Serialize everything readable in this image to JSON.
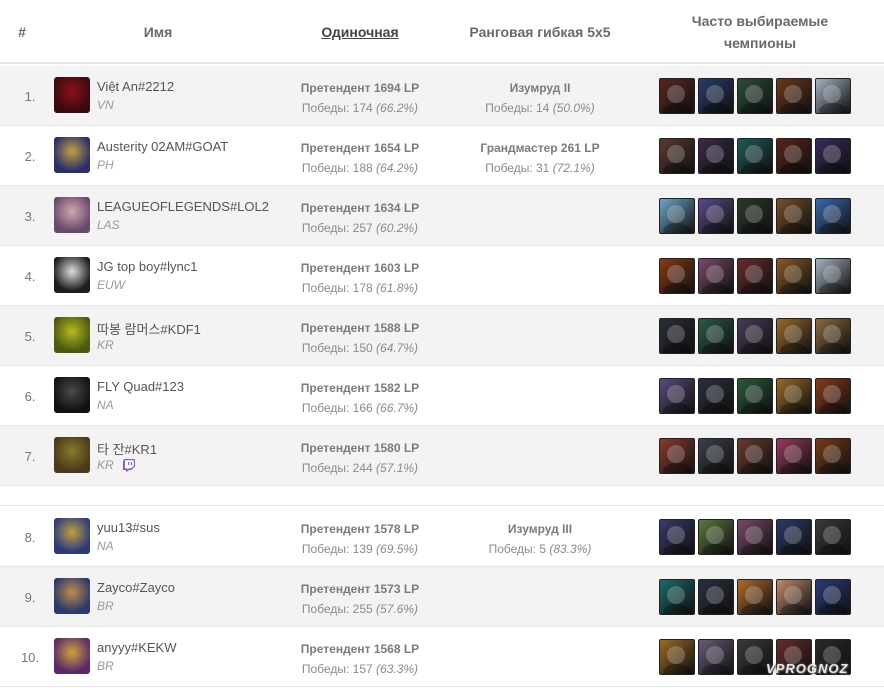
{
  "header": {
    "rank": "#",
    "name": "Имя",
    "solo": "Одиночная",
    "flex": "Ранговая гибкая 5х5",
    "champs_line1": "Часто выбираемые",
    "champs_line2": "чемпионы"
  },
  "rows": [
    {
      "rank": "1.",
      "name": "Việt An#2212",
      "region": "VN",
      "solo_tier": "Претендент 1694 LP",
      "solo_wins": "Победы: 174",
      "solo_wr": "(66.2%)",
      "flex_tier": "Изумруд II",
      "flex_wins": "Победы: 14",
      "flex_wr": "(50.0%)",
      "avatar_colors": [
        "#3a0a0e",
        "#8e1020"
      ],
      "champ_colors": [
        "#5a2620",
        "#283c6e",
        "#2a4e3a",
        "#6e3818",
        "#a4b2c0"
      ]
    },
    {
      "rank": "2.",
      "name": "Austerity 02AM#GOAT",
      "region": "PH",
      "solo_tier": "Претендент 1654 LP",
      "solo_wins": "Победы: 188",
      "solo_wr": "(64.2%)",
      "flex_tier": "Грандмастер 261 LP",
      "flex_wins": "Победы: 31",
      "flex_wr": "(72.1%)",
      "avatar_colors": [
        "#2a2e6a",
        "#c0a040"
      ],
      "champ_colors": [
        "#5a3a30",
        "#3c2a48",
        "#1e5a58",
        "#5a2418",
        "#3a2a5e"
      ]
    },
    {
      "rank": "3.",
      "name": "LEAGUEOFLEGENDS#LOL2",
      "region": "LAS",
      "solo_tier": "Претендент 1634 LP",
      "solo_wins": "Победы: 257",
      "solo_wr": "(60.2%)",
      "flex_tier": "",
      "flex_wins": "",
      "flex_wr": "",
      "avatar_colors": [
        "#6a4a6a",
        "#d0a8b0"
      ],
      "champ_colors": [
        "#6aa8c8",
        "#5a4a8a",
        "#2a3a2a",
        "#7a5028",
        "#3a6ab0"
      ]
    },
    {
      "rank": "4.",
      "name": "JG top boy#lync1",
      "region": "EUW",
      "solo_tier": "Претендент 1603 LP",
      "solo_wins": "Победы: 178",
      "solo_wr": "(61.8%)",
      "flex_tier": "",
      "flex_wins": "",
      "flex_wr": "",
      "avatar_colors": [
        "#1c1c1c",
        "#dddddd"
      ],
      "champ_colors": [
        "#8a3a14",
        "#7a4a6a",
        "#6a2a2e",
        "#8a5a24",
        "#a4b2c0"
      ]
    },
    {
      "rank": "5.",
      "name": "따봉 람머스#KDF1",
      "region": "KR",
      "solo_tier": "Претендент 1588 LP",
      "solo_wins": "Победы: 150",
      "solo_wr": "(64.7%)",
      "flex_tier": "",
      "flex_wins": "",
      "flex_wr": "",
      "avatar_colors": [
        "#4a5a10",
        "#b8b820"
      ],
      "champ_colors": [
        "#2a2e38",
        "#2a5a48",
        "#4a3a5a",
        "#9a6a2a",
        "#8a6a3a"
      ]
    },
    {
      "rank": "6.",
      "name": "FLY Quad#123",
      "region": "NA",
      "solo_tier": "Претендент 1582 LP",
      "solo_wins": "Победы: 166",
      "solo_wr": "(66.7%)",
      "flex_tier": "",
      "flex_wins": "",
      "flex_wr": "",
      "avatar_colors": [
        "#111111",
        "#4a4a4a"
      ],
      "champ_colors": [
        "#5a4a7a",
        "#2a3040",
        "#2a5a3a",
        "#9a6a24",
        "#8a3a18"
      ]
    },
    {
      "rank": "7.",
      "name": "타 잔#KR1",
      "region": "KR",
      "solo_tier": "Претендент 1580 LP",
      "solo_wins": "Победы: 244",
      "solo_wr": "(57.1%)",
      "flex_tier": "",
      "flex_wins": "",
      "flex_wr": "",
      "avatar_colors": [
        "#4a3a1a",
        "#8a7a2a"
      ],
      "champ_colors": [
        "#8a3a2e",
        "#3a4048",
        "#6a3a2a",
        "#9a3a5a",
        "#7a3a18"
      ]
    },
    {
      "rank": "8.",
      "name": "yuu13#sus",
      "region": "NA",
      "solo_tier": "Претендент 1578 LP",
      "solo_wins": "Победы: 139",
      "solo_wr": "(69.5%)",
      "flex_tier": "Изумруд III",
      "flex_wins": "Победы: 5",
      "flex_wr": "(83.3%)",
      "avatar_colors": [
        "#2a3a7a",
        "#c0a040"
      ],
      "champ_colors": [
        "#3a3a6a",
        "#5a7a3a",
        "#7a4a6a",
        "#2a3a6a",
        "#3a3a3a"
      ]
    },
    {
      "rank": "9.",
      "name": "Zayco#Zayco",
      "region": "BR",
      "solo_tier": "Претендент 1573 LP",
      "solo_wins": "Победы: 255",
      "solo_wr": "(57.6%)",
      "flex_tier": "",
      "flex_wins": "",
      "flex_wr": "",
      "avatar_colors": [
        "#2a3a6a",
        "#c08a4a"
      ],
      "champ_colors": [
        "#1a6a6a",
        "#2a3040",
        "#b06a2a",
        "#c08a6a",
        "#2a3a7a"
      ]
    },
    {
      "rank": "10.",
      "name": "anyyy#KEKW",
      "region": "BR",
      "solo_tier": "Претендент 1568 LP",
      "solo_wins": "Победы: 157",
      "solo_wr": "(63.3%)",
      "flex_tier": "",
      "flex_wins": "",
      "flex_wr": "",
      "avatar_colors": [
        "#5a2a6a",
        "#d0a040"
      ],
      "champ_colors": [
        "#9a6a24",
        "#6a5a7a",
        "#3a3a3a",
        "#6a2a2a",
        "#2a2a2a"
      ]
    }
  ],
  "watermark": "VPROGNOZ"
}
